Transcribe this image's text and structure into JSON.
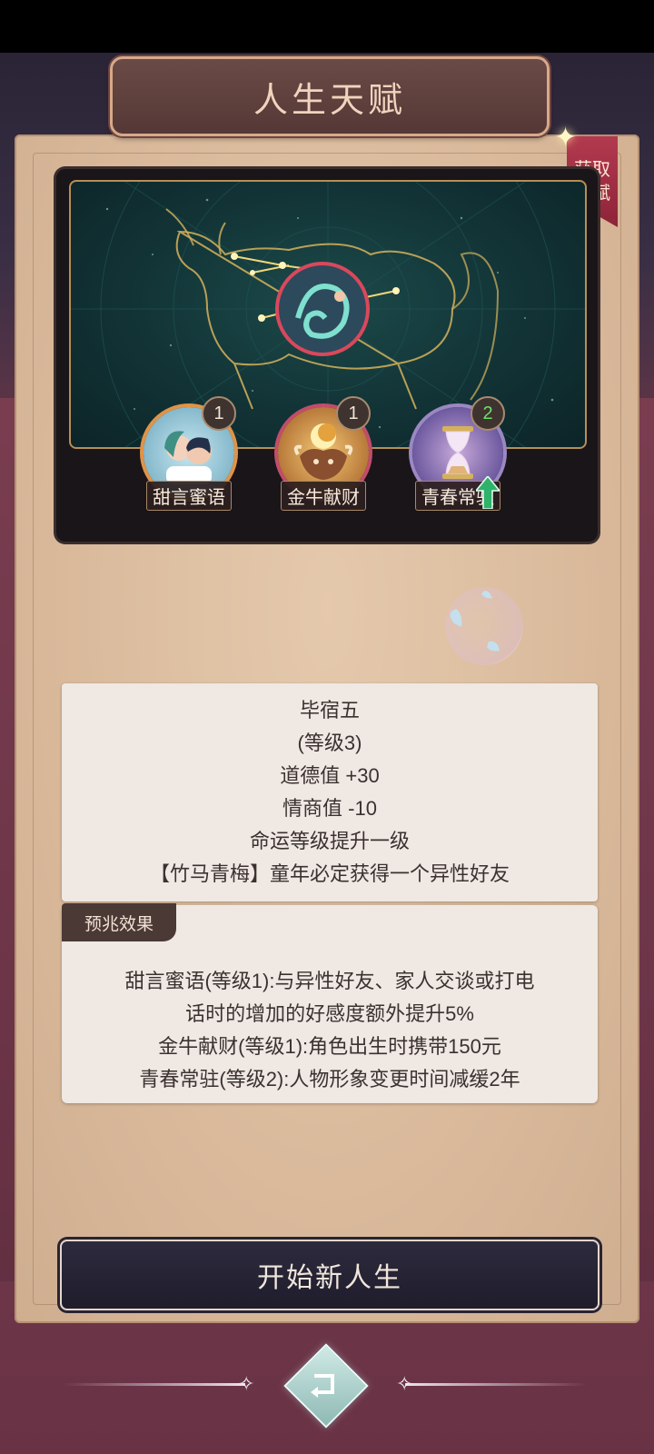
{
  "title": "人生天赋",
  "get_talent_ribbon": [
    "获取",
    "天赋"
  ],
  "talents": [
    {
      "name": "甜言蜜语",
      "level": "1",
      "icon": "couple-icon"
    },
    {
      "name": "金牛献财",
      "level": "1",
      "icon": "golden-bull-icon"
    },
    {
      "name": "青春常驻",
      "level": "2",
      "icon": "hourglass-icon",
      "upgrade": true
    }
  ],
  "info": {
    "name": "毕宿五",
    "level": "(等级3)",
    "effects": [
      "道德值 +30",
      "情商值 -10",
      "命运等级提升一级",
      "【竹马青梅】童年必定获得一个异性好友"
    ]
  },
  "omen": {
    "tag": "预兆效果",
    "lines": [
      "甜言蜜语(等级1):与异性好友、家人交谈或打电",
      "话时的增加的好感度额外提升5%",
      "金牛献财(等级1):角色出生时携带150元",
      "青春常驻(等级2):人物形象变更时间减缓2年"
    ]
  },
  "start_button": "开始新人生",
  "colors": {
    "accent": "#d7a98a",
    "panel": "#d9b99a",
    "background": "#6b3a4a",
    "button": "#2d2a3d"
  }
}
